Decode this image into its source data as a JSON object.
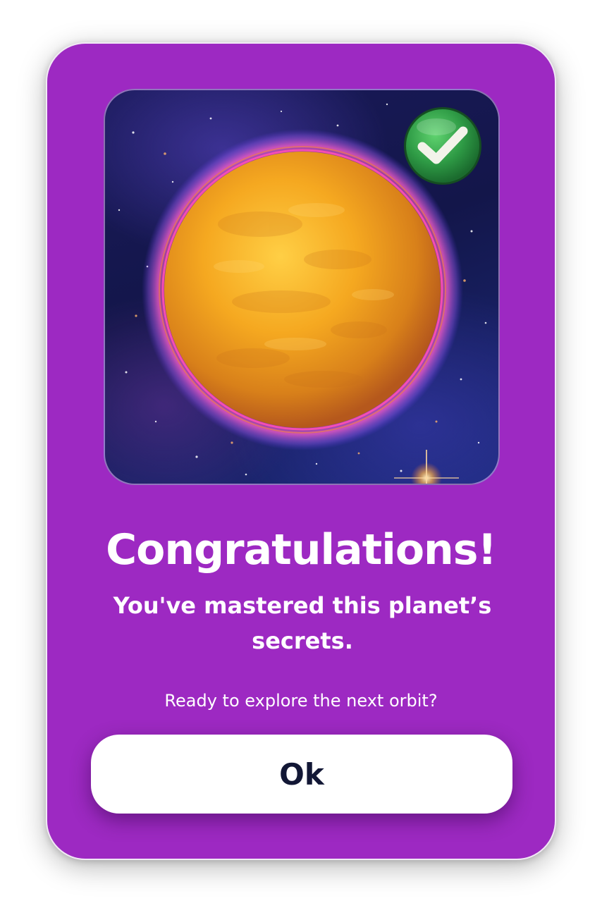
{
  "dialog": {
    "title": "Congratulations!",
    "subtitle": "You've mastered this planet’s secrets.",
    "prompt": "Ready to explore the next orbit?",
    "ok_label": "Ok"
  },
  "illustration": {
    "subject": "planet-icon",
    "badge": "checkmark-icon",
    "badge_color": "#2e9a45",
    "planet_color": "#f2a51f",
    "space_color": "#16184f"
  },
  "colors": {
    "dialog_background": "#9d29c2",
    "button_background": "#ffffff",
    "button_text": "#121735"
  }
}
